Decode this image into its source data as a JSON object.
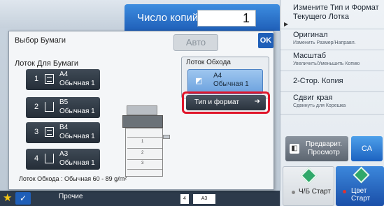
{
  "copies": {
    "label": "Число копий",
    "value": "1"
  },
  "dialog": {
    "title": "Выбор Бумаги",
    "auto_label": "Авто",
    "ok_label": "OK",
    "tray_label": "Лоток Для Бумаги",
    "trays": [
      {
        "num": "1",
        "size": "A4",
        "type": "Обычная 1"
      },
      {
        "num": "2",
        "size": "B5",
        "type": "Обычная 1"
      },
      {
        "num": "3",
        "size": "B4",
        "type": "Обычная 1"
      },
      {
        "num": "4",
        "size": "A3",
        "type": "Обычная 1"
      }
    ],
    "bypass": {
      "label": "Лоток Обхода",
      "size": "A4",
      "type": "Обычная 1"
    },
    "type_format_label": "Тип и формат",
    "bypass_info": "Лоток Обхода : Обычная 60 - 89 g/m²",
    "printer_tray_numbers": [
      "1",
      "2",
      "3"
    ]
  },
  "right_panel": {
    "items": [
      {
        "title": "Измените Тип и Формат Текущего Лотка",
        "sub": ""
      },
      {
        "title": "Оригинал",
        "sub": "Изменить Размер/Направл."
      },
      {
        "title": "Масштаб",
        "sub": "Увеличить/Уменьшить Копию"
      },
      {
        "title": "2-Стор. Копия",
        "sub": ""
      },
      {
        "title": "Сдвиг края",
        "sub": "Сдвинуть для Корешка"
      }
    ],
    "preview_label": "Предварит. Просмотр",
    "ca_label": "CA",
    "start_bw": "Ч/Б Старт",
    "start_color": "Цвет Старт"
  },
  "bottom_bar": {
    "other_label": "Прочие",
    "doc_count": "4",
    "doc_size": "A3"
  }
}
